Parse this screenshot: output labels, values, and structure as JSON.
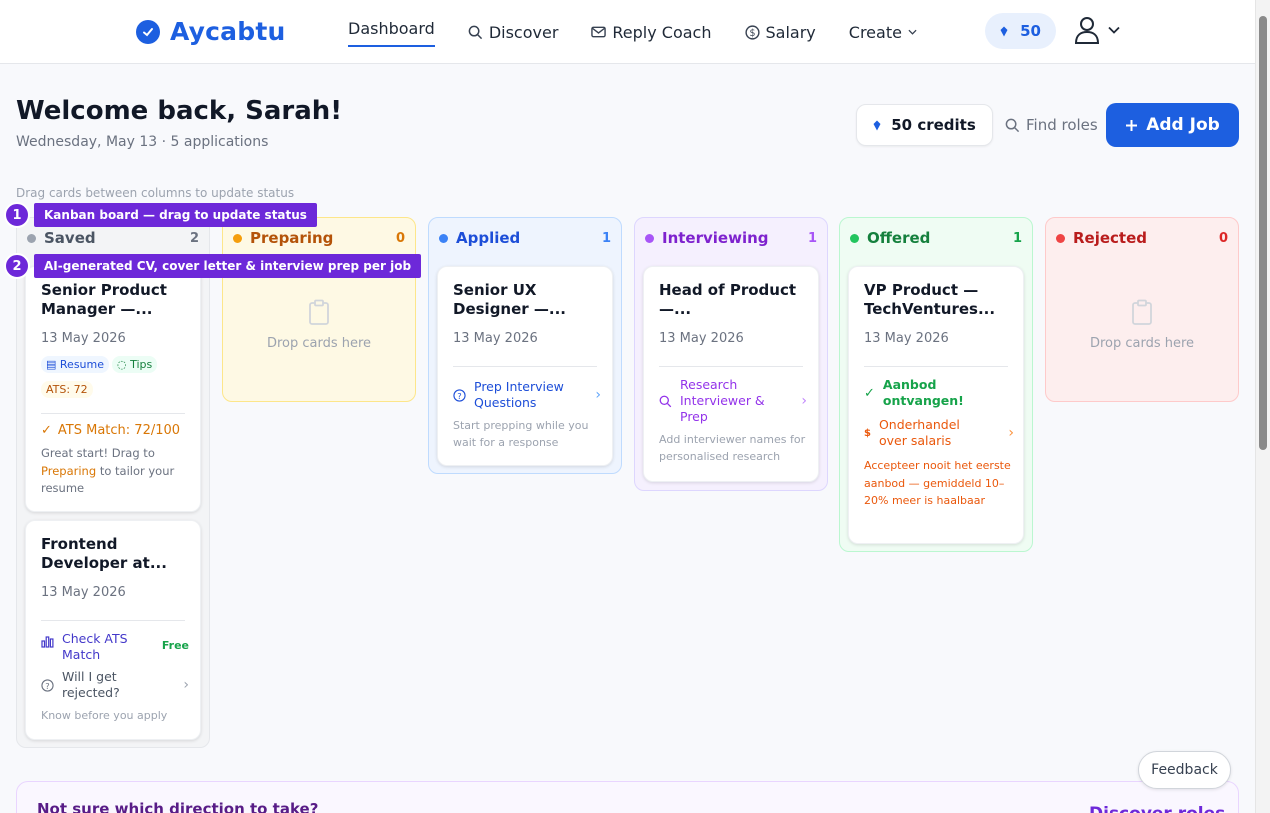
{
  "app": {
    "name": "Aycabtu"
  },
  "nav": {
    "dashboard": "Dashboard",
    "discover": "Discover",
    "reply_coach": "Reply Coach",
    "salary": "Salary",
    "create": "Create",
    "credits": "50"
  },
  "header": {
    "welcome": "Welcome back, Sarah!",
    "subtitle": "Wednesday, May 13 · 5 applications",
    "credits_button": "50 credits",
    "find_roles": "Find roles",
    "add_job": "Add Job",
    "drag_hint": "Drag cards between columns to update status"
  },
  "callouts": [
    {
      "number": "1",
      "label": "Kanban board — drag to update status"
    },
    {
      "number": "2",
      "label": "AI-generated CV, cover letter & interview prep per job"
    }
  ],
  "columns": {
    "saved": {
      "title": "Saved",
      "count": "2"
    },
    "preparing": {
      "title": "Preparing",
      "count": "0",
      "empty": "Drop cards here"
    },
    "applied": {
      "title": "Applied",
      "count": "1"
    },
    "interviewing": {
      "title": "Interviewing",
      "count": "1"
    },
    "offered": {
      "title": "Offered",
      "count": "1"
    },
    "rejected": {
      "title": "Rejected",
      "count": "0",
      "empty": "Drop cards here"
    }
  },
  "cards": {
    "saved_1": {
      "title": "Senior Product Manager —...",
      "date": "13 May 2026",
      "tag_resume": "Resume",
      "tag_tips": "Tips",
      "tag_ats": "ATS: 72",
      "ats_match": "ATS Match: 72/100",
      "note_a": "Great start! Drag to",
      "note_link": "Preparing",
      "note_b": "to tailor your resume"
    },
    "saved_2": {
      "title": "Frontend Developer at...",
      "date": "13 May 2026",
      "check_ats": "Check ATS Match",
      "free": "Free",
      "rejected_q": "Will I get rejected?",
      "know": "Know before you apply"
    },
    "applied_1": {
      "title": "Senior UX Designer —...",
      "date": "13 May 2026",
      "action": "Prep Interview Questions",
      "note": "Start prepping while you wait for a response"
    },
    "interviewing_1": {
      "title": "Head of Product —...",
      "date": "13 May 2026",
      "action": "Research Interviewer & Prep",
      "note": "Add interviewer names for personalised research"
    },
    "offered_1": {
      "title": "VP Product — TechVentures...",
      "date": "13 May 2026",
      "received": "Aanbod ontvangen!",
      "negotiate": "Onderhandel over salaris",
      "advice": "Accepteer nooit het eerste aanbod — gemiddeld 10–20% meer is haalbaar"
    }
  },
  "footer": {
    "feedback": "Feedback",
    "direction_title": "Not sure which direction to take?",
    "direction_link": "Discover roles"
  },
  "colors": {
    "brand": "#1d5fe0",
    "callout": "#6d28d9",
    "saved": "#9ca3af",
    "preparing": "#f59e0b",
    "applied": "#3b82f6",
    "interviewing": "#a855f7",
    "offered": "#22c55e",
    "rejected": "#ef4444"
  }
}
